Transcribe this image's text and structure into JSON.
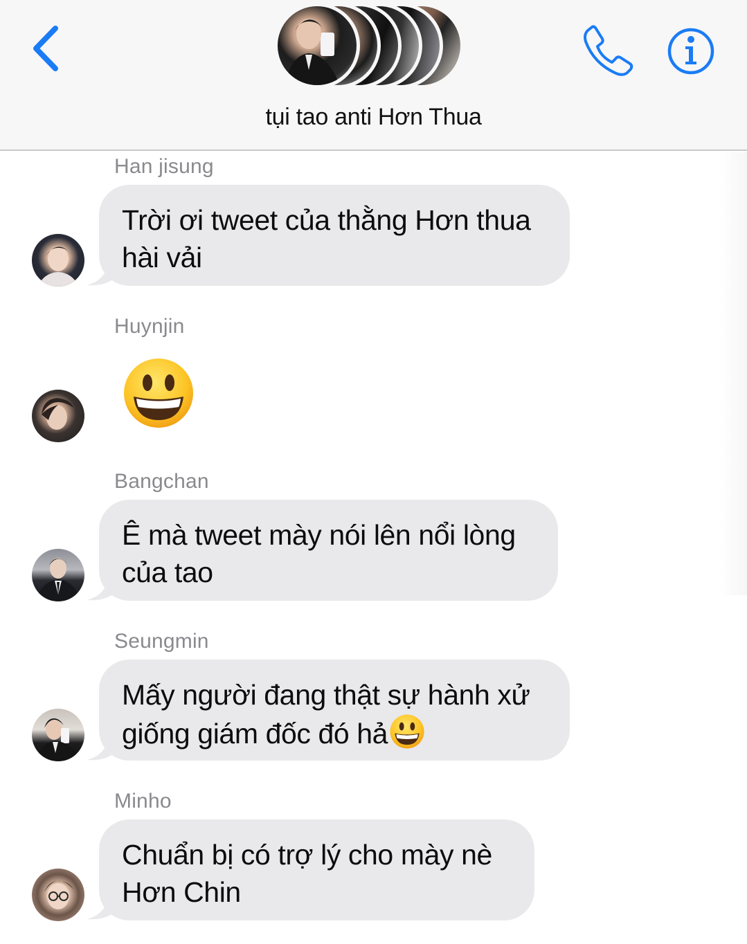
{
  "header": {
    "group_name": "tụi tao anti Hơn Thua",
    "back_icon": "chevron-left-icon",
    "call_icon": "phone-icon",
    "info_icon": "info-circle-icon"
  },
  "colors": {
    "accent": "#1a7cf5",
    "bubble_bg": "#e9e9eb",
    "sender_name": "#8a8a8e",
    "header_bg": "#f7f7f7"
  },
  "messages": [
    {
      "sender": "Han jisung",
      "text_line1": "Trời ơi tweet của thằng Hơn thua",
      "text_line2": "hài vải"
    },
    {
      "sender": "Huynjin",
      "emoji": "grinning-face-emoji"
    },
    {
      "sender": "Bangchan",
      "text_line1": "Ê mà tweet mày nói lên nổi lòng",
      "text_line2": "của tao"
    },
    {
      "sender": "Seungmin",
      "text_line1": "Mấy người đang thật sự hành xử",
      "text_line2": "giống giám đốc đó hả",
      "trailing_emoji": "grinning-face-emoji"
    },
    {
      "sender": "Minho",
      "text_line1": "Chuẩn bị có trợ lý cho mày nè",
      "text_line2": "Hơn Chin"
    }
  ]
}
